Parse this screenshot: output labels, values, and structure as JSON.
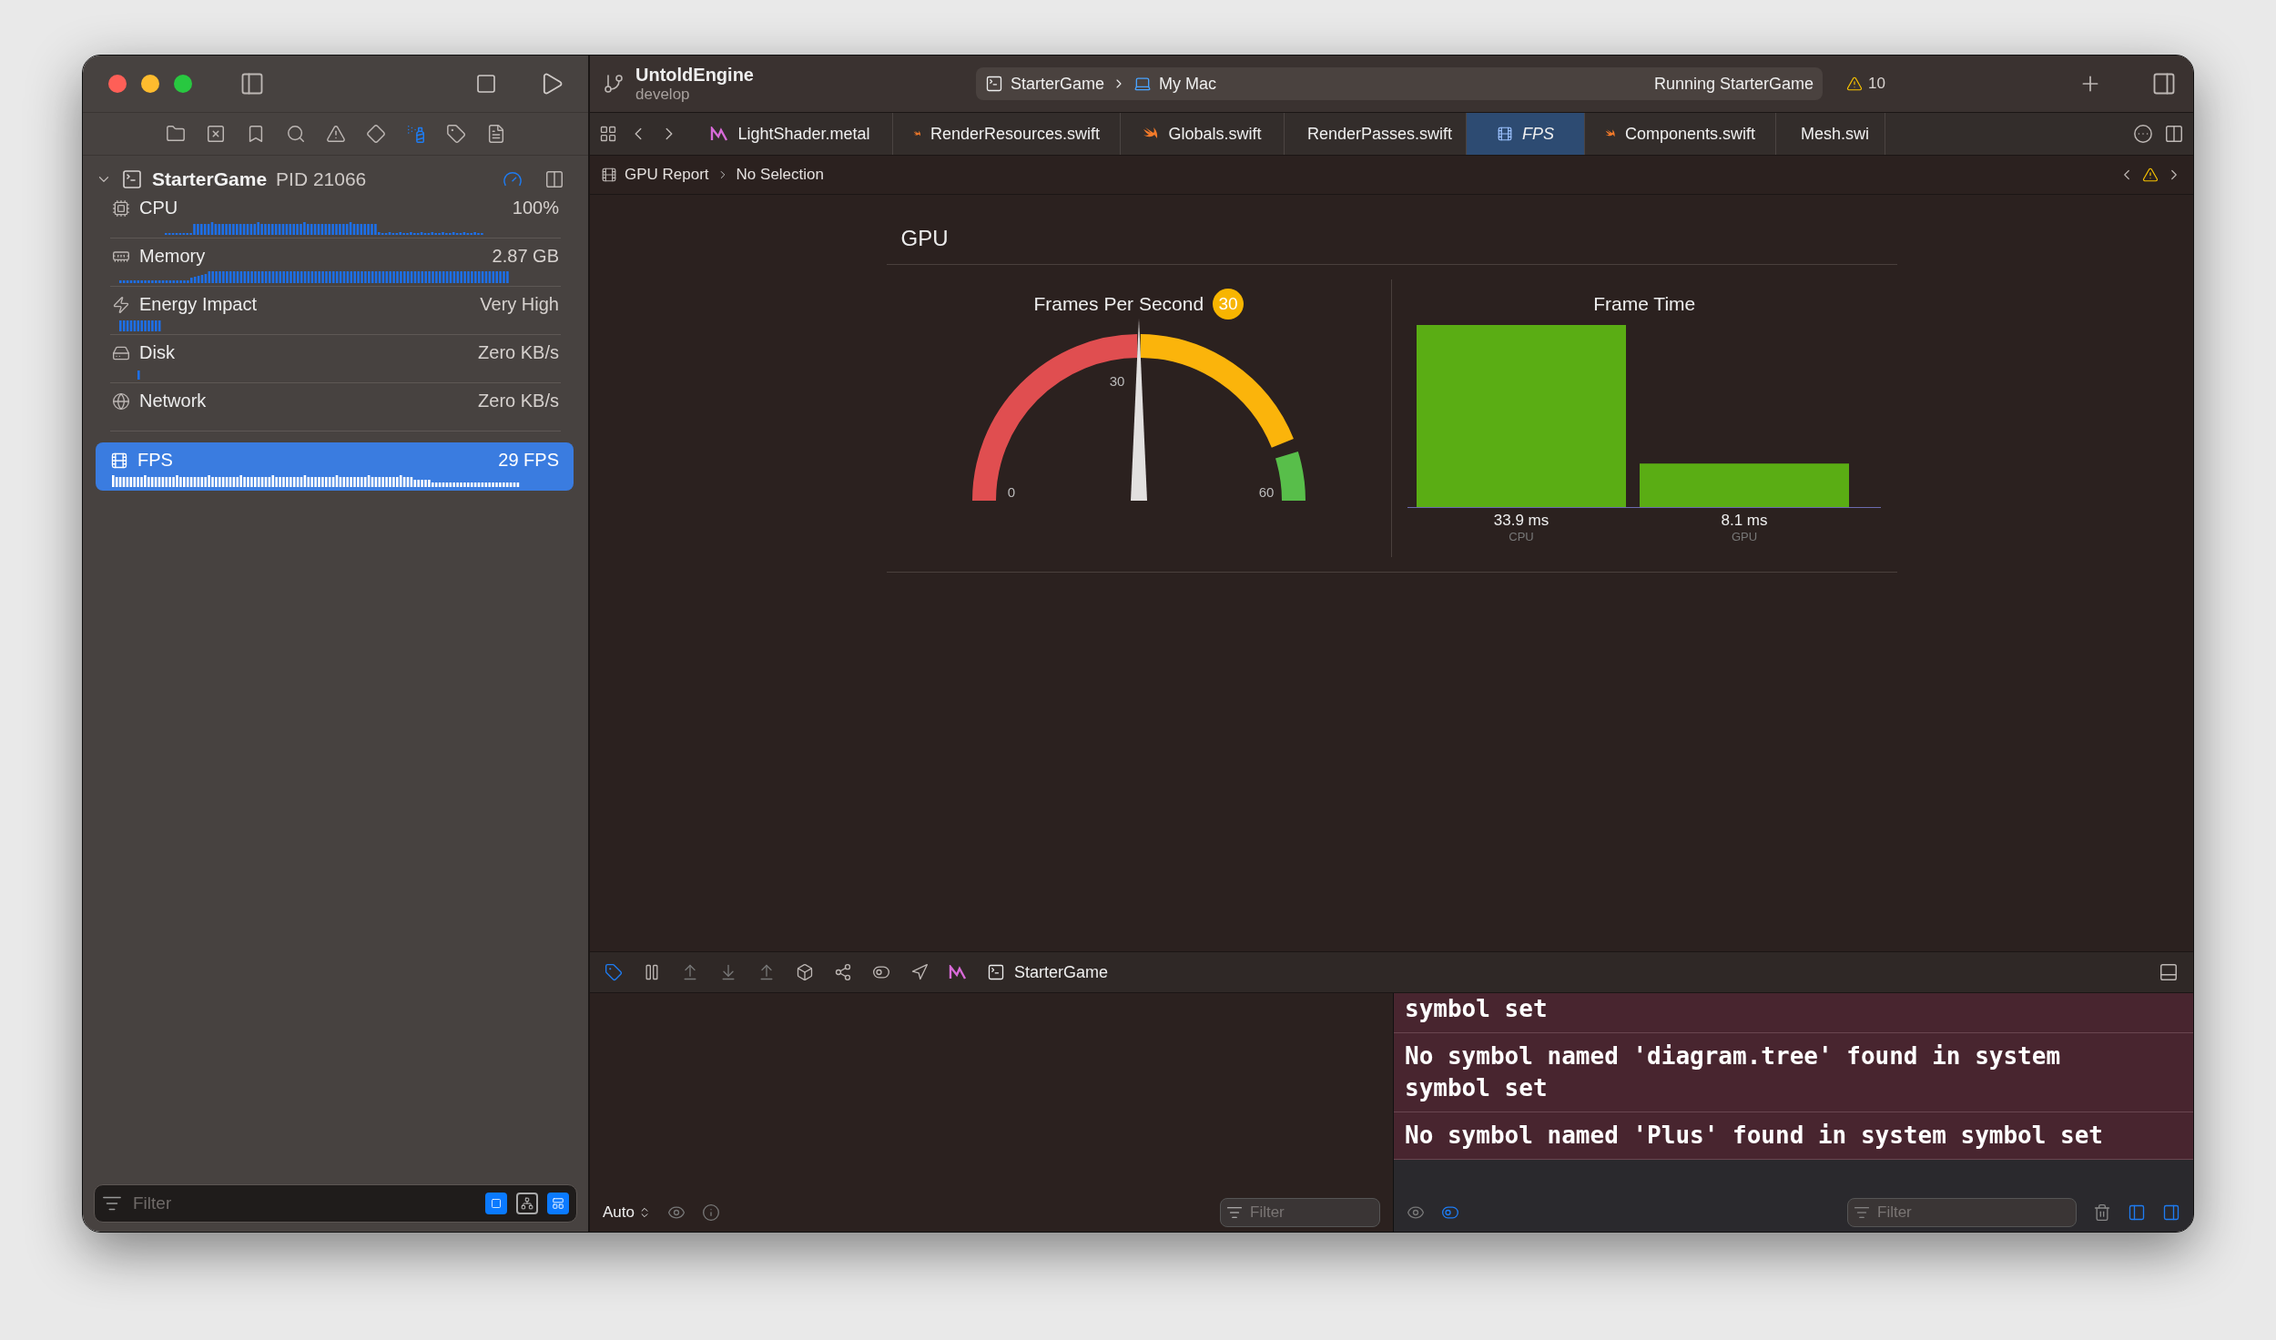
{
  "toolbar": {
    "project": "UntoldEngine",
    "branch": "develop",
    "scheme": "StarterGame",
    "destination": "My Mac",
    "status": "Running StarterGame",
    "warnings": "10"
  },
  "tabs": [
    {
      "label": "LightShader.metal",
      "kind": "metal",
      "selected": false
    },
    {
      "label": "RenderResources.swift",
      "kind": "swift",
      "selected": false
    },
    {
      "label": "Globals.swift",
      "kind": "swift",
      "selected": false
    },
    {
      "label": "RenderPasses.swift",
      "kind": "swift",
      "selected": false
    },
    {
      "label": "FPS",
      "kind": "report",
      "selected": true
    },
    {
      "label": "Components.swift",
      "kind": "swift",
      "selected": false
    },
    {
      "label": "Mesh.swi",
      "kind": "swift",
      "selected": false
    }
  ],
  "breadcrumb": [
    "GPU Report",
    "No Selection"
  ],
  "navigator": {
    "process": {
      "name": "StarterGame",
      "pid": "PID 21066",
      "expanded": true
    },
    "gauges": [
      {
        "label": "CPU",
        "value": "100%",
        "kind": "cpu",
        "selected": false
      },
      {
        "label": "Memory",
        "value": "2.87 GB",
        "kind": "memory",
        "selected": false
      },
      {
        "label": "Energy Impact",
        "value": "Very High",
        "kind": "energy",
        "selected": false
      },
      {
        "label": "Disk",
        "value": "Zero KB/s",
        "kind": "disk",
        "selected": false
      },
      {
        "label": "Network",
        "value": "Zero KB/s",
        "kind": "network",
        "selected": false
      },
      {
        "label": "FPS",
        "value": "29 FPS",
        "kind": "fps",
        "selected": true
      }
    ],
    "filter_placeholder": "Filter"
  },
  "report": {
    "title": "GPU",
    "fps": {
      "title": "Frames Per Second",
      "badge": "30",
      "level": 0.5,
      "min_label": "0",
      "mid_label": "30",
      "max_label": "60"
    },
    "frame_time": {
      "chart_data": {
        "type": "bar",
        "title": "Frame Time",
        "categories": [
          "CPU",
          "GPU"
        ],
        "values": [
          33.9,
          8.1
        ],
        "value_labels": [
          "33.9 ms",
          "8.1 ms"
        ]
      }
    }
  },
  "debug_bar": {
    "target": "StarterGame"
  },
  "variables": {
    "scope": "Auto",
    "filter_placeholder": "Filter"
  },
  "console": {
    "messages": [
      "symbol set",
      "No symbol named 'diagram.tree' found in system symbol set",
      "No symbol named 'Plus' found in system symbol set"
    ],
    "filter_placeholder": "Filter"
  }
}
